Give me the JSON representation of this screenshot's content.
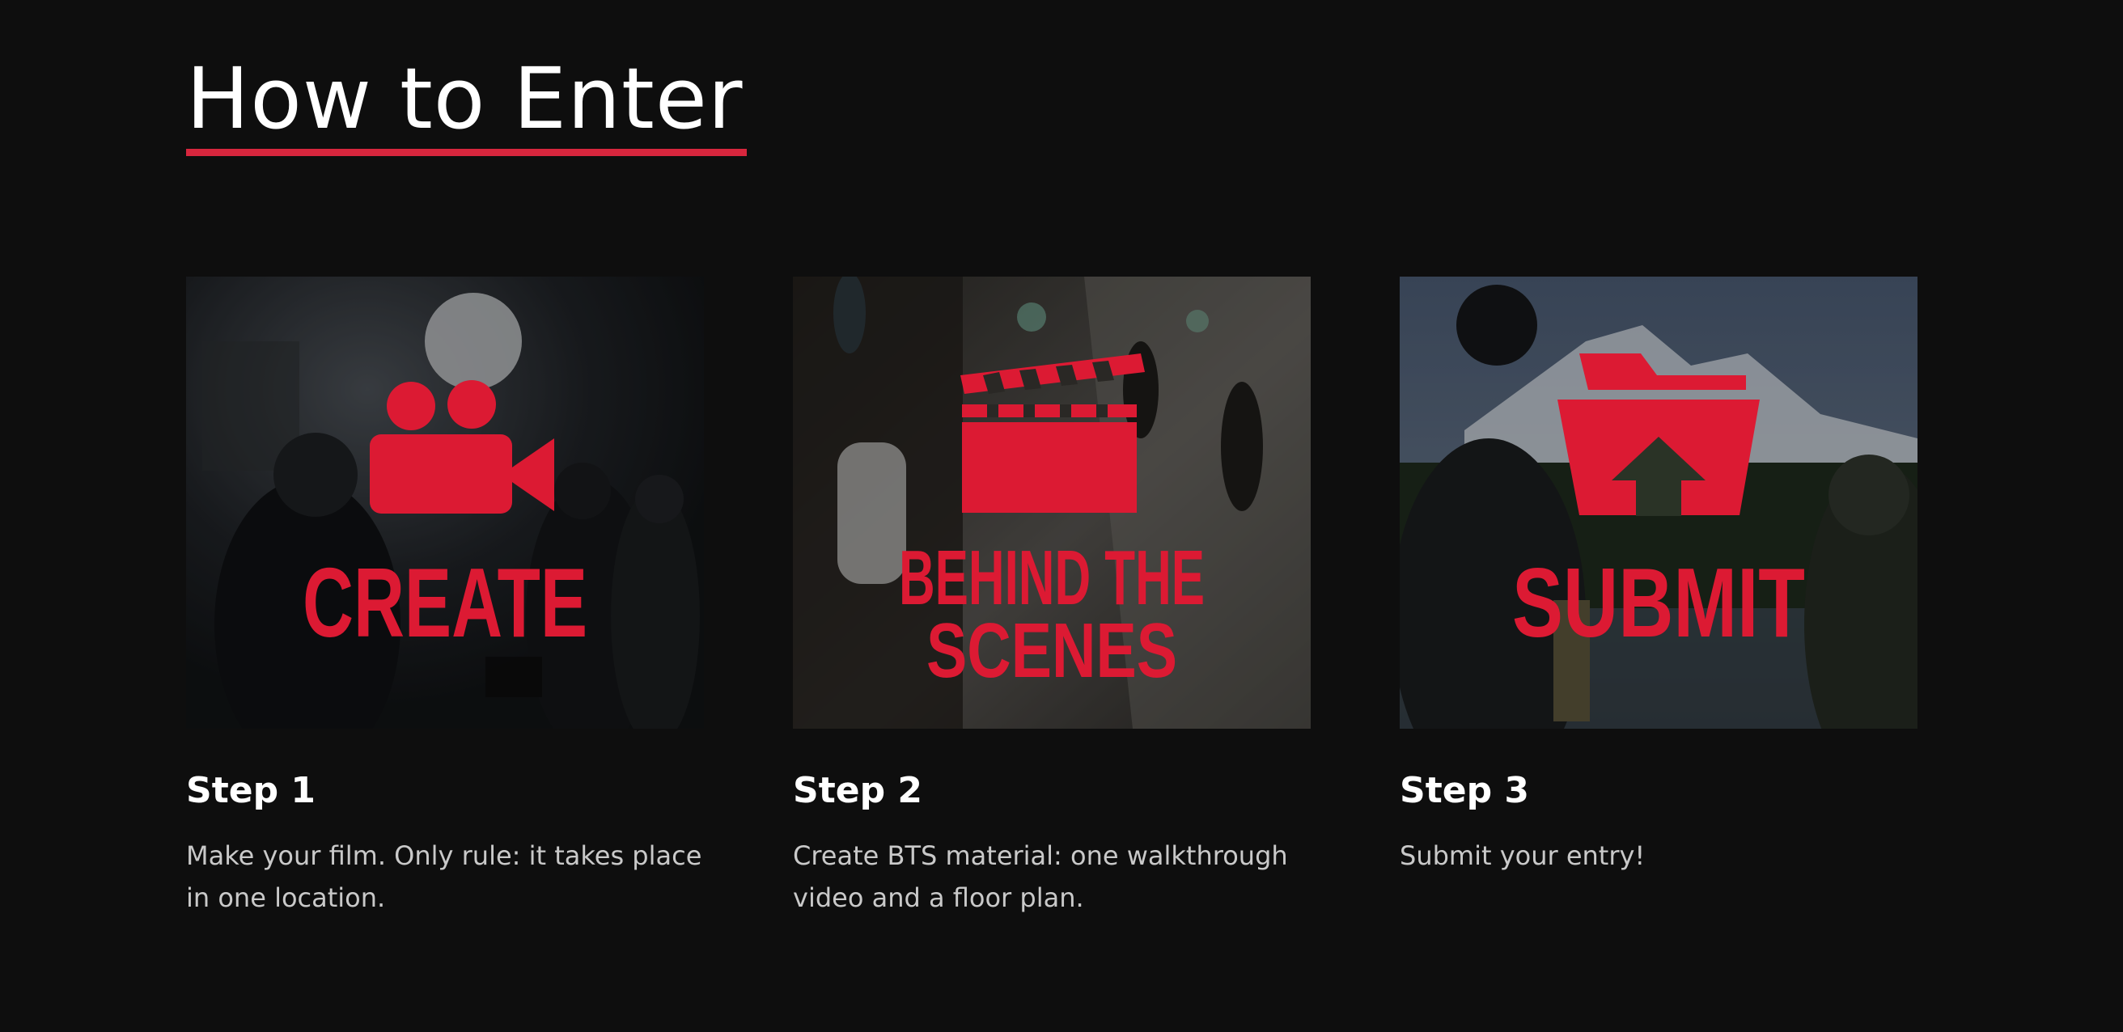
{
  "header": {
    "title": "How to Enter"
  },
  "colors": {
    "background": "#0e0e0e",
    "accent": "#d7263d",
    "icon_red": "#dc1a33",
    "body_text": "#c9c9c9"
  },
  "steps": [
    {
      "image_label": "CREATE",
      "icon": "video-camera-icon",
      "title": "Step 1",
      "description": "Make your film. Only rule: it takes place in one location."
    },
    {
      "image_label_line1": "BEHIND THE",
      "image_label_line2": "SCENES",
      "icon": "clapperboard-icon",
      "title": "Step 2",
      "description": "Create BTS material: one walkthrough video and a floor plan."
    },
    {
      "image_label": "SUBMIT",
      "icon": "folder-upload-icon",
      "title": "Step 3",
      "description": "Submit your entry!"
    }
  ]
}
